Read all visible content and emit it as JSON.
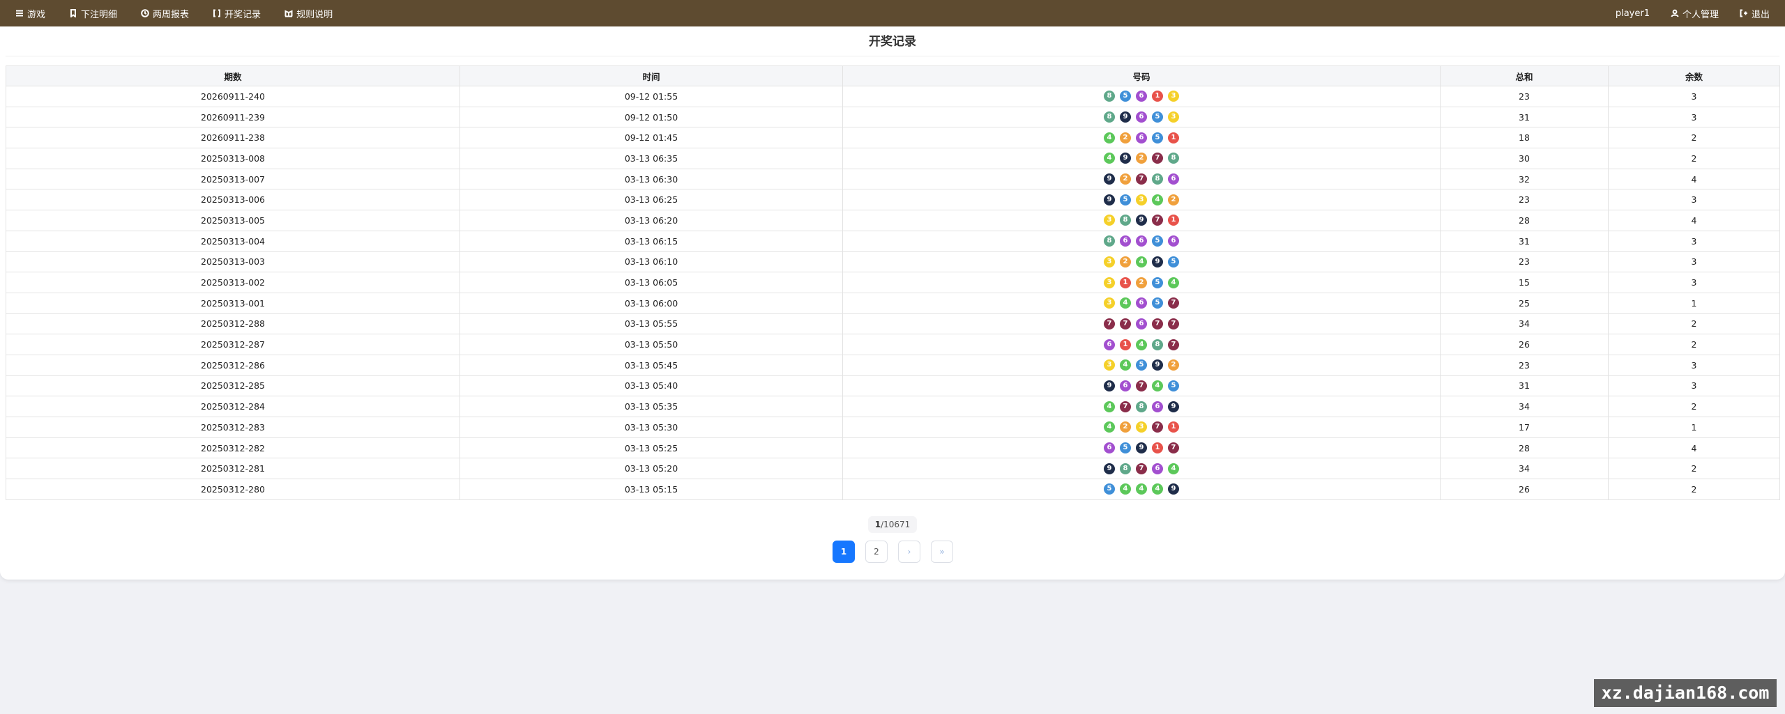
{
  "nav": {
    "items": [
      {
        "label": "游戏",
        "icon": "menu-icon"
      },
      {
        "label": "下注明细",
        "icon": "bookmark-icon"
      },
      {
        "label": "两周报表",
        "icon": "clock-icon"
      },
      {
        "label": "开奖记录",
        "icon": "bracket-icon"
      },
      {
        "label": "规则说明",
        "icon": "rules-icon"
      }
    ],
    "username": "player1",
    "account_label": "个人管理",
    "logout_label": "退出"
  },
  "page": {
    "title": "开奖记录"
  },
  "table": {
    "headers": [
      "期数",
      "时间",
      "号码",
      "总和",
      "余数"
    ],
    "rows": [
      {
        "issue": "20260911-240",
        "time": "09-12 01:55",
        "numbers": [
          8,
          5,
          6,
          1,
          3
        ],
        "sum": "23",
        "remainder": "3"
      },
      {
        "issue": "20260911-239",
        "time": "09-12 01:50",
        "numbers": [
          8,
          9,
          6,
          5,
          3
        ],
        "sum": "31",
        "remainder": "3"
      },
      {
        "issue": "20260911-238",
        "time": "09-12 01:45",
        "numbers": [
          4,
          2,
          6,
          5,
          1
        ],
        "sum": "18",
        "remainder": "2"
      },
      {
        "issue": "20250313-008",
        "time": "03-13 06:35",
        "numbers": [
          4,
          9,
          2,
          7,
          8
        ],
        "sum": "30",
        "remainder": "2"
      },
      {
        "issue": "20250313-007",
        "time": "03-13 06:30",
        "numbers": [
          9,
          2,
          7,
          8,
          6
        ],
        "sum": "32",
        "remainder": "4"
      },
      {
        "issue": "20250313-006",
        "time": "03-13 06:25",
        "numbers": [
          9,
          5,
          3,
          4,
          2
        ],
        "sum": "23",
        "remainder": "3"
      },
      {
        "issue": "20250313-005",
        "time": "03-13 06:20",
        "numbers": [
          3,
          8,
          9,
          7,
          1
        ],
        "sum": "28",
        "remainder": "4"
      },
      {
        "issue": "20250313-004",
        "time": "03-13 06:15",
        "numbers": [
          8,
          6,
          6,
          5,
          6
        ],
        "sum": "31",
        "remainder": "3"
      },
      {
        "issue": "20250313-003",
        "time": "03-13 06:10",
        "numbers": [
          3,
          2,
          4,
          9,
          5
        ],
        "sum": "23",
        "remainder": "3"
      },
      {
        "issue": "20250313-002",
        "time": "03-13 06:05",
        "numbers": [
          3,
          1,
          2,
          5,
          4
        ],
        "sum": "15",
        "remainder": "3"
      },
      {
        "issue": "20250313-001",
        "time": "03-13 06:00",
        "numbers": [
          3,
          4,
          6,
          5,
          7
        ],
        "sum": "25",
        "remainder": "1"
      },
      {
        "issue": "20250312-288",
        "time": "03-13 05:55",
        "numbers": [
          7,
          7,
          6,
          7,
          7
        ],
        "sum": "34",
        "remainder": "2"
      },
      {
        "issue": "20250312-287",
        "time": "03-13 05:50",
        "numbers": [
          6,
          1,
          4,
          8,
          7
        ],
        "sum": "26",
        "remainder": "2"
      },
      {
        "issue": "20250312-286",
        "time": "03-13 05:45",
        "numbers": [
          3,
          4,
          5,
          9,
          2
        ],
        "sum": "23",
        "remainder": "3"
      },
      {
        "issue": "20250312-285",
        "time": "03-13 05:40",
        "numbers": [
          9,
          6,
          7,
          4,
          5
        ],
        "sum": "31",
        "remainder": "3"
      },
      {
        "issue": "20250312-284",
        "time": "03-13 05:35",
        "numbers": [
          4,
          7,
          8,
          6,
          9
        ],
        "sum": "34",
        "remainder": "2"
      },
      {
        "issue": "20250312-283",
        "time": "03-13 05:30",
        "numbers": [
          4,
          2,
          3,
          7,
          1
        ],
        "sum": "17",
        "remainder": "1"
      },
      {
        "issue": "20250312-282",
        "time": "03-13 05:25",
        "numbers": [
          6,
          5,
          9,
          1,
          7
        ],
        "sum": "28",
        "remainder": "4"
      },
      {
        "issue": "20250312-281",
        "time": "03-13 05:20",
        "numbers": [
          9,
          8,
          7,
          6,
          4
        ],
        "sum": "34",
        "remainder": "2"
      },
      {
        "issue": "20250312-280",
        "time": "03-13 05:15",
        "numbers": [
          5,
          4,
          4,
          4,
          9
        ],
        "sum": "26",
        "remainder": "2"
      }
    ]
  },
  "ball_colors": {
    "1": "#e8524a",
    "2": "#f0a03c",
    "3": "#f5d029",
    "4": "#5cc85a",
    "5": "#3f8fd8",
    "6": "#a24fcf",
    "7": "#8a2d4a",
    "8": "#5fa88a",
    "9": "#1f2d4a"
  },
  "pagination": {
    "current": "1",
    "total": "/10671",
    "pages": [
      "1",
      "2"
    ],
    "next": "›",
    "last": "»"
  },
  "watermark": "xz.dajian168.com"
}
